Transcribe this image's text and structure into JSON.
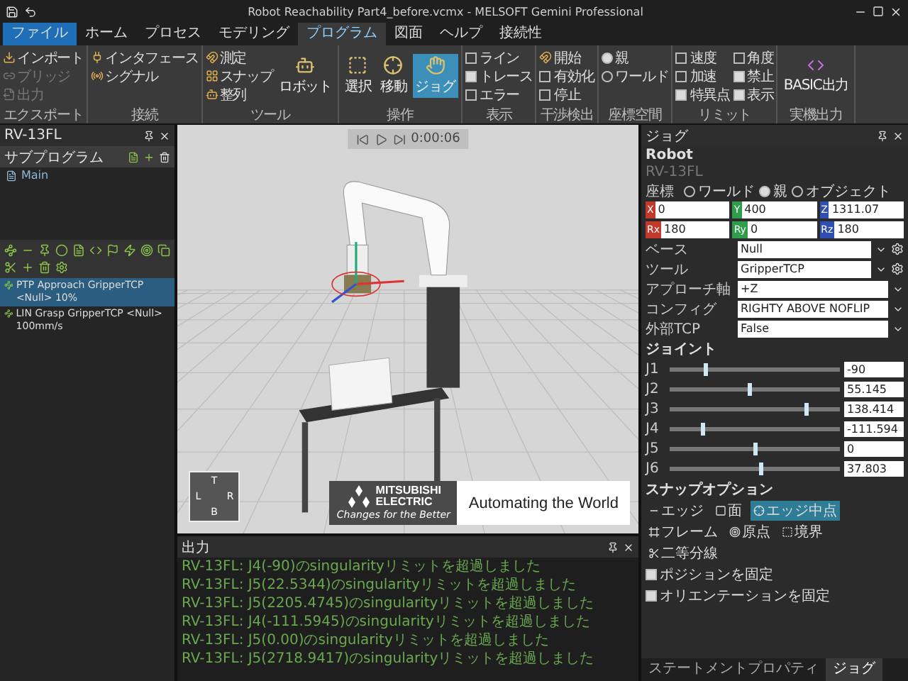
{
  "window": {
    "title": "Robot Reachability Part4_before.vcmx - MELSOFT Gemini Professional"
  },
  "menu_tabs": [
    {
      "label": "ファイル",
      "kind": "file",
      "selected": false
    },
    {
      "label": "ホーム",
      "kind": "tab",
      "selected": false
    },
    {
      "label": "プロセス",
      "kind": "tab",
      "selected": false
    },
    {
      "label": "モデリング",
      "kind": "tab",
      "selected": false
    },
    {
      "label": "プログラム",
      "kind": "tab",
      "selected": true
    },
    {
      "label": "図面",
      "kind": "tab",
      "selected": false
    },
    {
      "label": "ヘルプ",
      "kind": "tab",
      "selected": false
    },
    {
      "label": "接続性",
      "kind": "tab",
      "selected": false
    }
  ],
  "ribbon": [
    {
      "label": "エクスポート",
      "items": [
        {
          "kind": "button",
          "label": "インポート",
          "disabled": false
        },
        {
          "kind": "button",
          "label": "ブリッジ",
          "disabled": true
        },
        {
          "kind": "button",
          "label": "出力",
          "disabled": true
        }
      ]
    },
    {
      "label": "接続",
      "items": [
        {
          "kind": "button",
          "label": "インタフェース",
          "disabled": false
        },
        {
          "kind": "button",
          "label": "シグナル",
          "disabled": false
        }
      ]
    },
    {
      "label": "ツール",
      "items": [
        {
          "kind": "button",
          "label": "測定",
          "disabled": false
        },
        {
          "kind": "button",
          "label": "スナップ",
          "disabled": false
        },
        {
          "kind": "button",
          "label": "整列",
          "disabled": false
        },
        {
          "kind": "large",
          "label": "ロボット",
          "selected": false
        }
      ]
    },
    {
      "label": "操作",
      "items": [
        {
          "kind": "large",
          "label": "選択",
          "selected": false
        },
        {
          "kind": "large",
          "label": "移動",
          "selected": false
        },
        {
          "kind": "large",
          "label": "ジョグ",
          "selected": true
        }
      ]
    },
    {
      "label": "表示",
      "items": [
        {
          "kind": "check",
          "label": "ライン",
          "checked": false
        },
        {
          "kind": "check",
          "label": "トレース",
          "checked": true
        },
        {
          "kind": "check",
          "label": "エラー",
          "checked": false
        }
      ]
    },
    {
      "label": "干渉検出",
      "items": [
        {
          "kind": "button",
          "label": "開始",
          "disabled": false
        },
        {
          "kind": "check",
          "label": "有効化",
          "checked": false
        },
        {
          "kind": "check",
          "label": "停止",
          "checked": false
        }
      ]
    },
    {
      "label": "座標空間",
      "items": [
        {
          "kind": "radio",
          "label": "親",
          "selected": true
        },
        {
          "kind": "radio",
          "label": "ワールド",
          "selected": false
        }
      ]
    },
    {
      "label": "リミット",
      "items": [
        {
          "kind": "check",
          "label": "速度",
          "checked": false
        },
        {
          "kind": "check",
          "label": "加速",
          "checked": false
        },
        {
          "kind": "check",
          "label": "特異点",
          "checked": true
        },
        {
          "kind": "check",
          "label": "角度",
          "checked": false
        },
        {
          "kind": "check",
          "label": "禁止",
          "checked": true
        },
        {
          "kind": "check",
          "label": "表示",
          "checked": true
        }
      ]
    },
    {
      "label": "実機出力",
      "items": [
        {
          "kind": "button",
          "label": "BASIC出力",
          "disabled": false
        }
      ]
    }
  ],
  "program_panel": {
    "title": "RV-13FL",
    "subprograms_title": "サブプログラム",
    "subprograms": [
      {
        "label": "Main",
        "selected": false
      }
    ],
    "statements": [
      {
        "label": "PTP Approach GripperTCP <Null> 10%",
        "selected": true
      },
      {
        "label": "LIN Grasp GripperTCP <Null> 100mm/s",
        "selected": false
      }
    ]
  },
  "viewport": {
    "time": "0:00:06",
    "nav_cube": [
      "T",
      "L",
      "R",
      "B"
    ]
  },
  "output": {
    "title": "出力",
    "lines": [
      "RV-13FL: J4(-90)のsingularityリミットを超過しました",
      "RV-13FL: J5(22.5344)のsingularityリミットを超過しました",
      "RV-13FL: J5(2205.4745)のsingularityリミットを超過しました",
      "RV-13FL: J4(-111.5945)のsingularityリミットを超過しました",
      "RV-13FL: J5(0.00)のsingularityリミットを超過しました",
      "RV-13FL: J5(2718.9417)のsingularityリミットを超過しました"
    ]
  },
  "jog": {
    "title": "ジョグ",
    "robot_section": "Robot",
    "robot_name": "RV-13FL",
    "coord_label": "座標",
    "coord_options": [
      {
        "label": "ワールド",
        "selected": false
      },
      {
        "label": "親",
        "selected": true
      },
      {
        "label": "オブジェクト",
        "selected": false
      }
    ],
    "fields": [
      {
        "axis": "X",
        "value": "0",
        "color": "#c0392b"
      },
      {
        "axis": "Y",
        "value": "400",
        "color": "#2e9e4a"
      },
      {
        "axis": "Z",
        "value": "1311.07",
        "color": "#2f4fb0"
      },
      {
        "axis": "Rx",
        "value": "180",
        "color": "#c0392b"
      },
      {
        "axis": "Ry",
        "value": "0",
        "color": "#2e9e4a"
      },
      {
        "axis": "Rz",
        "value": "180",
        "color": "#2f4fb0"
      }
    ],
    "props": [
      {
        "label": "ベース",
        "value": "Null",
        "gear": true
      },
      {
        "label": "ツール",
        "value": "GripperTCP",
        "gear": true
      },
      {
        "label": "アプローチ軸",
        "value": "+Z",
        "gear": false
      },
      {
        "label": "コンフィグ",
        "value": "RIGHTY ABOVE NOFLIP",
        "gear": false
      },
      {
        "label": "外部TCP",
        "value": "False",
        "gear": false
      }
    ],
    "joints_section": "ジョイント",
    "joints": [
      {
        "label": "J1",
        "value": "-90",
        "level": 0.21
      },
      {
        "label": "J2",
        "value": "55.145",
        "level": 0.47
      },
      {
        "label": "J3",
        "value": "138.414",
        "level": 0.8
      },
      {
        "label": "J4",
        "value": "-111.594",
        "level": 0.19
      },
      {
        "label": "J5",
        "value": "0",
        "level": 0.5
      },
      {
        "label": "J6",
        "value": "37.803",
        "level": 0.53
      }
    ],
    "snap_section": "スナップオプション",
    "snap_options": [
      {
        "label": "エッジ",
        "selected": false
      },
      {
        "label": "面",
        "selected": false
      },
      {
        "label": "エッジ中点",
        "selected": true
      },
      {
        "label": "フレーム",
        "selected": false
      },
      {
        "label": "原点",
        "selected": false
      },
      {
        "label": "境界",
        "selected": false
      },
      {
        "label": "二等分線",
        "selected": false
      }
    ],
    "locks": [
      {
        "label": "ポジションを固定",
        "checked": true
      },
      {
        "label": "オリエンテーションを固定",
        "checked": true
      }
    ]
  },
  "bottom_tabs": [
    {
      "label": "ステートメントプロパティ",
      "selected": false
    },
    {
      "label": "ジョグ",
      "selected": true
    }
  ],
  "banner": {
    "brand_lines": [
      "MITSUBISHI",
      "ELECTRIC"
    ],
    "tagline": "Changes for the Better",
    "slogan": "Automating the World"
  }
}
